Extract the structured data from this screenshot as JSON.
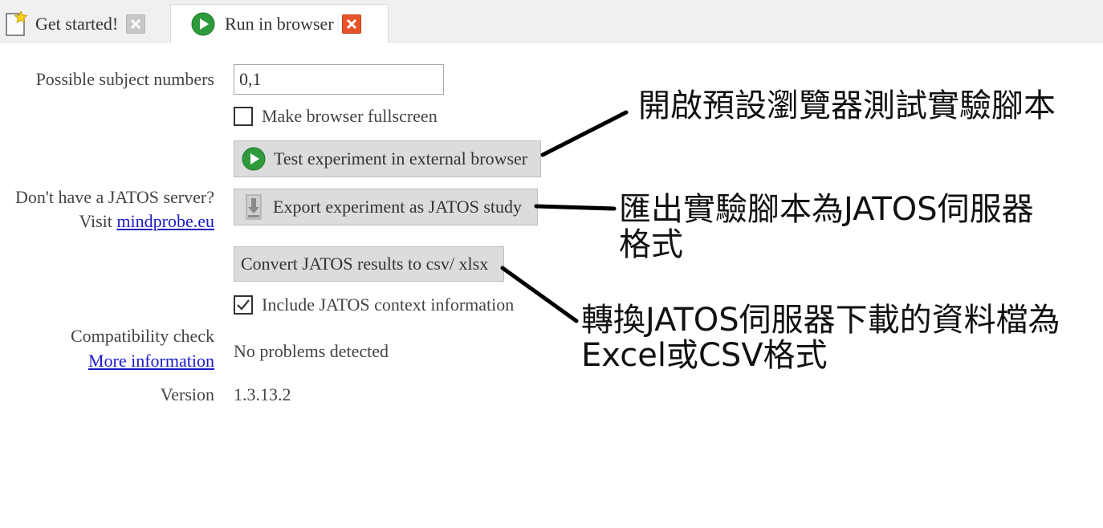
{
  "tabs": [
    {
      "label": "Get started!",
      "icon": "document-star-icon",
      "active": false
    },
    {
      "label": "Run in browser",
      "icon": "play-icon",
      "active": true
    }
  ],
  "form": {
    "subject_numbers_label": "Possible subject numbers",
    "subject_numbers_value": "0,1",
    "fullscreen_label": "Make browser fullscreen",
    "fullscreen_checked": false,
    "test_button_label": "Test experiment in external browser",
    "server_question": "Don't have a JATOS server?",
    "visit_text": "Visit",
    "server_link": "mindprobe.eu",
    "export_button_label": "Export experiment as JATOS study",
    "convert_button_label": "Convert JATOS results to csv/ xlsx",
    "context_label": "Include JATOS context information",
    "context_checked": true,
    "compat_label": "Compatibility check",
    "compat_link": "More information",
    "compat_value": "No problems detected",
    "version_label": "Version",
    "version_value": "1.3.13.2"
  },
  "annotations": {
    "test": "開啟預設瀏覽器測試實驗腳本",
    "export_line1": "匯出實驗腳本為JATOS伺服器",
    "export_line2": "格式",
    "convert_line1": "轉換JATOS伺服器下載的資料檔為",
    "convert_line2": "Excel或CSV格式"
  },
  "colors": {
    "play_green": "#2e9a3c",
    "close_red": "#e8542a",
    "link_blue": "#1a1ac8"
  }
}
